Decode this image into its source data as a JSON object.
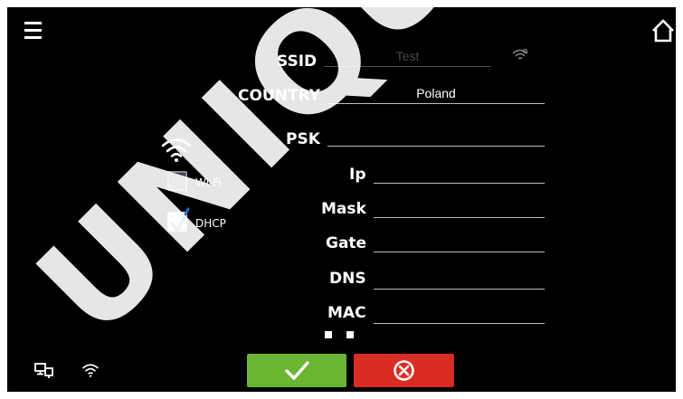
{
  "watermark": "UNIQUE",
  "form": {
    "ssid_label": "SSID",
    "ssid_value": "Test",
    "country_label": "COUNTRY",
    "country_value": "Poland",
    "psk_label": "PSK",
    "psk_value": "",
    "ip_label": "Ip",
    "ip_value": "",
    "mask_label": "Mask",
    "mask_value": "",
    "gate_label": "Gate",
    "gate_value": "",
    "dns_label": "DNS",
    "dns_value": "",
    "mac_label": "MAC",
    "mac_value": ""
  },
  "options": {
    "wifi_label": "Wi-Fi",
    "wifi_checked": false,
    "dhcp_label": "DHCP",
    "dhcp_checked": true
  },
  "colors": {
    "background": "#000000",
    "confirm": "#6cb533",
    "cancel": "#d92c22",
    "checkmark": "#1f6fd1"
  },
  "icons": {
    "menu": "menu-icon",
    "home": "home-icon",
    "wifi": "wifi-icon",
    "wifi_search": "wifi-search-icon",
    "network": "network-icon",
    "confirm": "checkmark-icon",
    "cancel": "cancel-icon"
  }
}
